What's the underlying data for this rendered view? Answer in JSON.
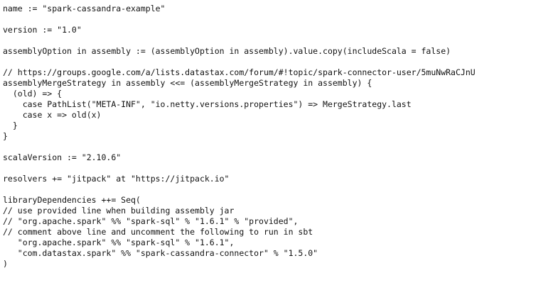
{
  "document": {
    "lines": [
      "name := \"spark-cassandra-example\"",
      "",
      "version := \"1.0\"",
      "",
      "assemblyOption in assembly := (assemblyOption in assembly).value.copy(includeScala = false)",
      "",
      "// https://groups.google.com/a/lists.datastax.com/forum/#!topic/spark-connector-user/5muNwRaCJnU",
      "assemblyMergeStrategy in assembly <<= (assemblyMergeStrategy in assembly) {",
      "  (old) => {",
      "    case PathList(\"META-INF\", \"io.netty.versions.properties\") => MergeStrategy.last",
      "    case x => old(x)",
      "  }",
      "}",
      "",
      "scalaVersion := \"2.10.6\"",
      "",
      "resolvers += \"jitpack\" at \"https://jitpack.io\"",
      "",
      "libraryDependencies ++= Seq(",
      "// use provided line when building assembly jar",
      "// \"org.apache.spark\" %% \"spark-sql\" % \"1.6.1\" % \"provided\",",
      "// comment above line and uncomment the following to run in sbt",
      "   \"org.apache.spark\" %% \"spark-sql\" % \"1.6.1\",",
      "   \"com.datastax.spark\" %% \"spark-cassandra-connector\" % \"1.5.0\"",
      ")"
    ]
  }
}
